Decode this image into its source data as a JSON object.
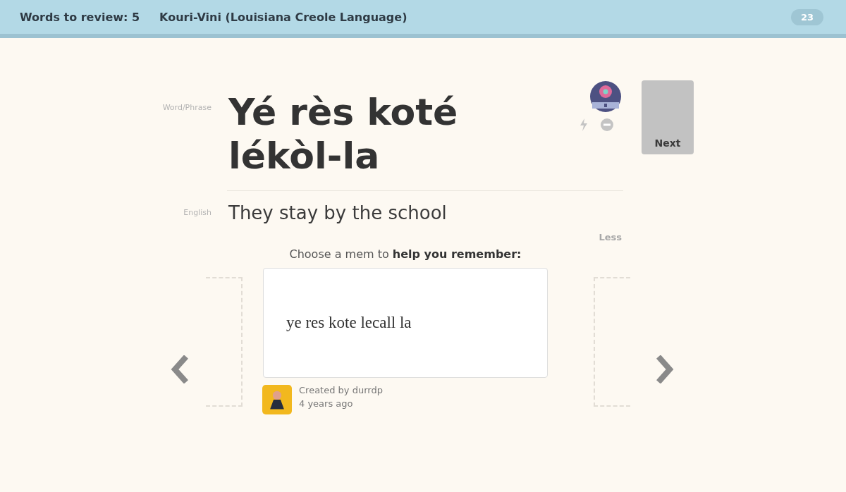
{
  "header": {
    "review_count": "Words to review: 5",
    "course": "Kouri-Vini (Louisiana Creole Language)",
    "points": "23"
  },
  "word": {
    "label": "Word/Phrase",
    "text": "Yé rès koté lékòl-la"
  },
  "english": {
    "label": "English",
    "text": "They stay by the school"
  },
  "next_button": "Next",
  "less_link": "Less",
  "mem": {
    "prompt": "Choose a mem to **help you remember:**",
    "text": "ye res kote lecall la",
    "creator": "Created by durrdp",
    "age": "4 years ago"
  }
}
